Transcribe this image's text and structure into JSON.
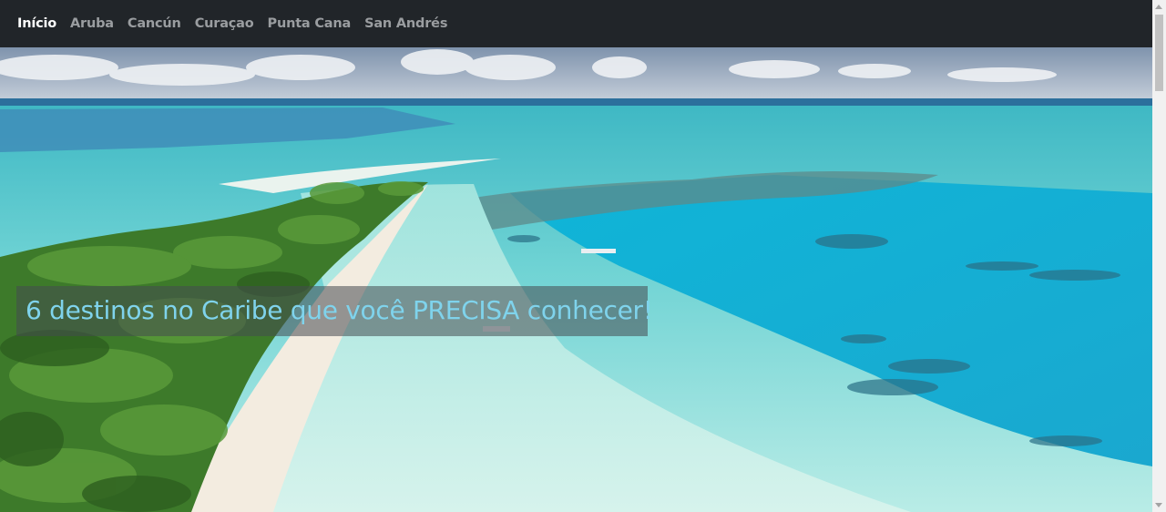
{
  "navbar": {
    "items": [
      {
        "label": "Início",
        "active": true
      },
      {
        "label": "Aruba"
      },
      {
        "label": "Cancún"
      },
      {
        "label": "Curaçao"
      },
      {
        "label": "Punta Cana"
      },
      {
        "label": "San Andrés"
      }
    ]
  },
  "hero": {
    "title": "6 destinos no Caribe que você PRECISA conhecer!"
  },
  "colors": {
    "navbar_bg": "#212529",
    "nav_active": "#ffffff",
    "nav_inactive": "#9a9da0",
    "title_text": "#7fd3ec"
  }
}
